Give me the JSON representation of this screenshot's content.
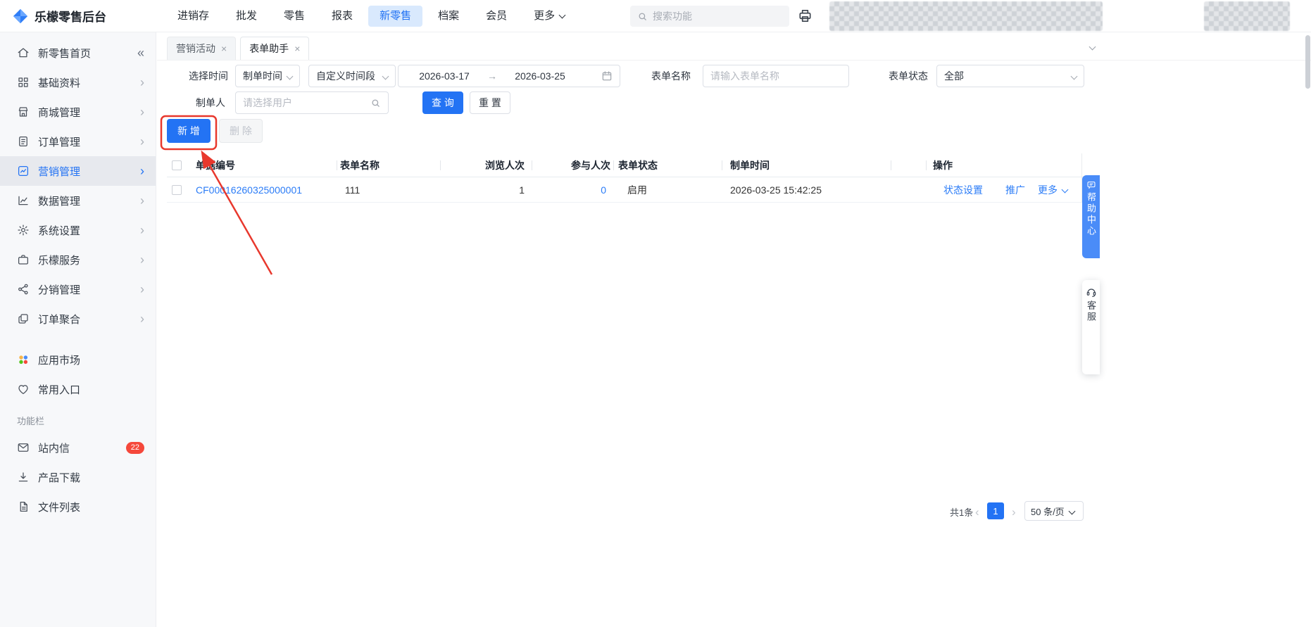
{
  "colors": {
    "primary": "#2373f4",
    "link_blue": "#2b7cf7",
    "badge_red": "#f5483b",
    "annotation_red": "#e8382d"
  },
  "topbar": {
    "logo_text": "乐檬零售后台",
    "nav": [
      {
        "label": "进销存"
      },
      {
        "label": "批发"
      },
      {
        "label": "零售"
      },
      {
        "label": "报表"
      },
      {
        "label": "新零售"
      },
      {
        "label": "档案"
      },
      {
        "label": "会员"
      },
      {
        "label": "更多"
      }
    ],
    "search_placeholder": "搜索功能"
  },
  "sidebar": {
    "items": [
      {
        "label": "新零售首页",
        "icon": "home-icon"
      },
      {
        "label": "基础资料",
        "icon": "grid-icon"
      },
      {
        "label": "商城管理",
        "icon": "store-icon"
      },
      {
        "label": "订单管理",
        "icon": "order-icon"
      },
      {
        "label": "营销管理",
        "icon": "marketing-icon",
        "active": true
      },
      {
        "label": "数据管理",
        "icon": "data-chart-icon"
      },
      {
        "label": "系统设置",
        "icon": "gear-icon"
      },
      {
        "label": "乐檬服务",
        "icon": "briefcase-icon"
      },
      {
        "label": "分销管理",
        "icon": "share-icon"
      },
      {
        "label": "订单聚合",
        "icon": "stack-icon"
      }
    ],
    "shortcuts": [
      {
        "label": "应用市场",
        "icon": "apps-icon"
      },
      {
        "label": "常用入口",
        "icon": "heart-icon"
      }
    ],
    "section_label": "功能栏",
    "tools": [
      {
        "label": "站内信",
        "icon": "mail-icon",
        "badge": "22"
      },
      {
        "label": "产品下载",
        "icon": "download-icon"
      },
      {
        "label": "文件列表",
        "icon": "file-icon"
      }
    ]
  },
  "tabs": [
    {
      "label": "营销活动"
    },
    {
      "label": "表单助手"
    }
  ],
  "filters": {
    "time_label": "选择时间",
    "time_type": "制单时间",
    "range_type": "自定义时间段",
    "date_from": "2026-03-17",
    "date_to": "2026-03-25",
    "form_name_label": "表单名称",
    "form_name_placeholder": "请输入表单名称",
    "form_status_label": "表单状态",
    "form_status_value": "全部",
    "maker_label": "制单人",
    "maker_placeholder": "请选择用户",
    "query_button": "查 询",
    "reset_button": "重 置"
  },
  "toolbar": {
    "add_button": "新 增",
    "delete_button": "删 除"
  },
  "table": {
    "headers": [
      "单据编号",
      "表单名称",
      "浏览人次",
      "参与人次",
      "表单状态",
      "制单时间",
      "操作"
    ],
    "row": {
      "doc_no": "CF00016260325000001",
      "form_name": "111",
      "views": "1",
      "participants": "0",
      "status": "启用",
      "created_at": "2026-03-25 15:42:25",
      "op_status": "状态设置",
      "op_promote": "推广",
      "op_more": "更多",
      "clipped_text": "6"
    }
  },
  "pagination": {
    "total": "共1条",
    "page": "1",
    "page_size": "50 条/页"
  },
  "float_widgets": {
    "help_center": "帮助中心",
    "customer_service": "客服"
  }
}
